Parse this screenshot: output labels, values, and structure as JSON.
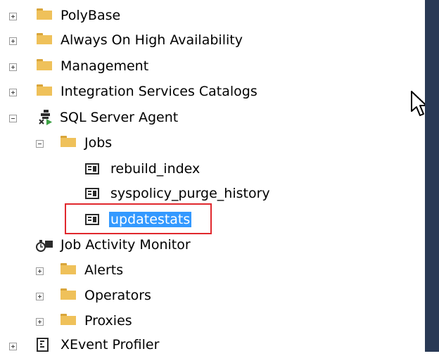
{
  "tree": {
    "polybase": "PolyBase",
    "always_on": "Always On High Availability",
    "management": "Management",
    "integration_services": "Integration Services Catalogs",
    "sql_server_agent": "SQL Server Agent",
    "jobs": "Jobs",
    "job_items": [
      "rebuild_index",
      "syspolicy_purge_history",
      "updatestats"
    ],
    "job_activity_monitor": "Job Activity Monitor",
    "alerts": "Alerts",
    "operators": "Operators",
    "proxies": "Proxies",
    "xevent_profiler": "XEvent Profiler"
  },
  "colors": {
    "selection": "#3399ff",
    "highlight_border": "#e0282d",
    "folder": "#efc15a",
    "scrollbar": "#293955"
  },
  "selected_item": "updatestats"
}
